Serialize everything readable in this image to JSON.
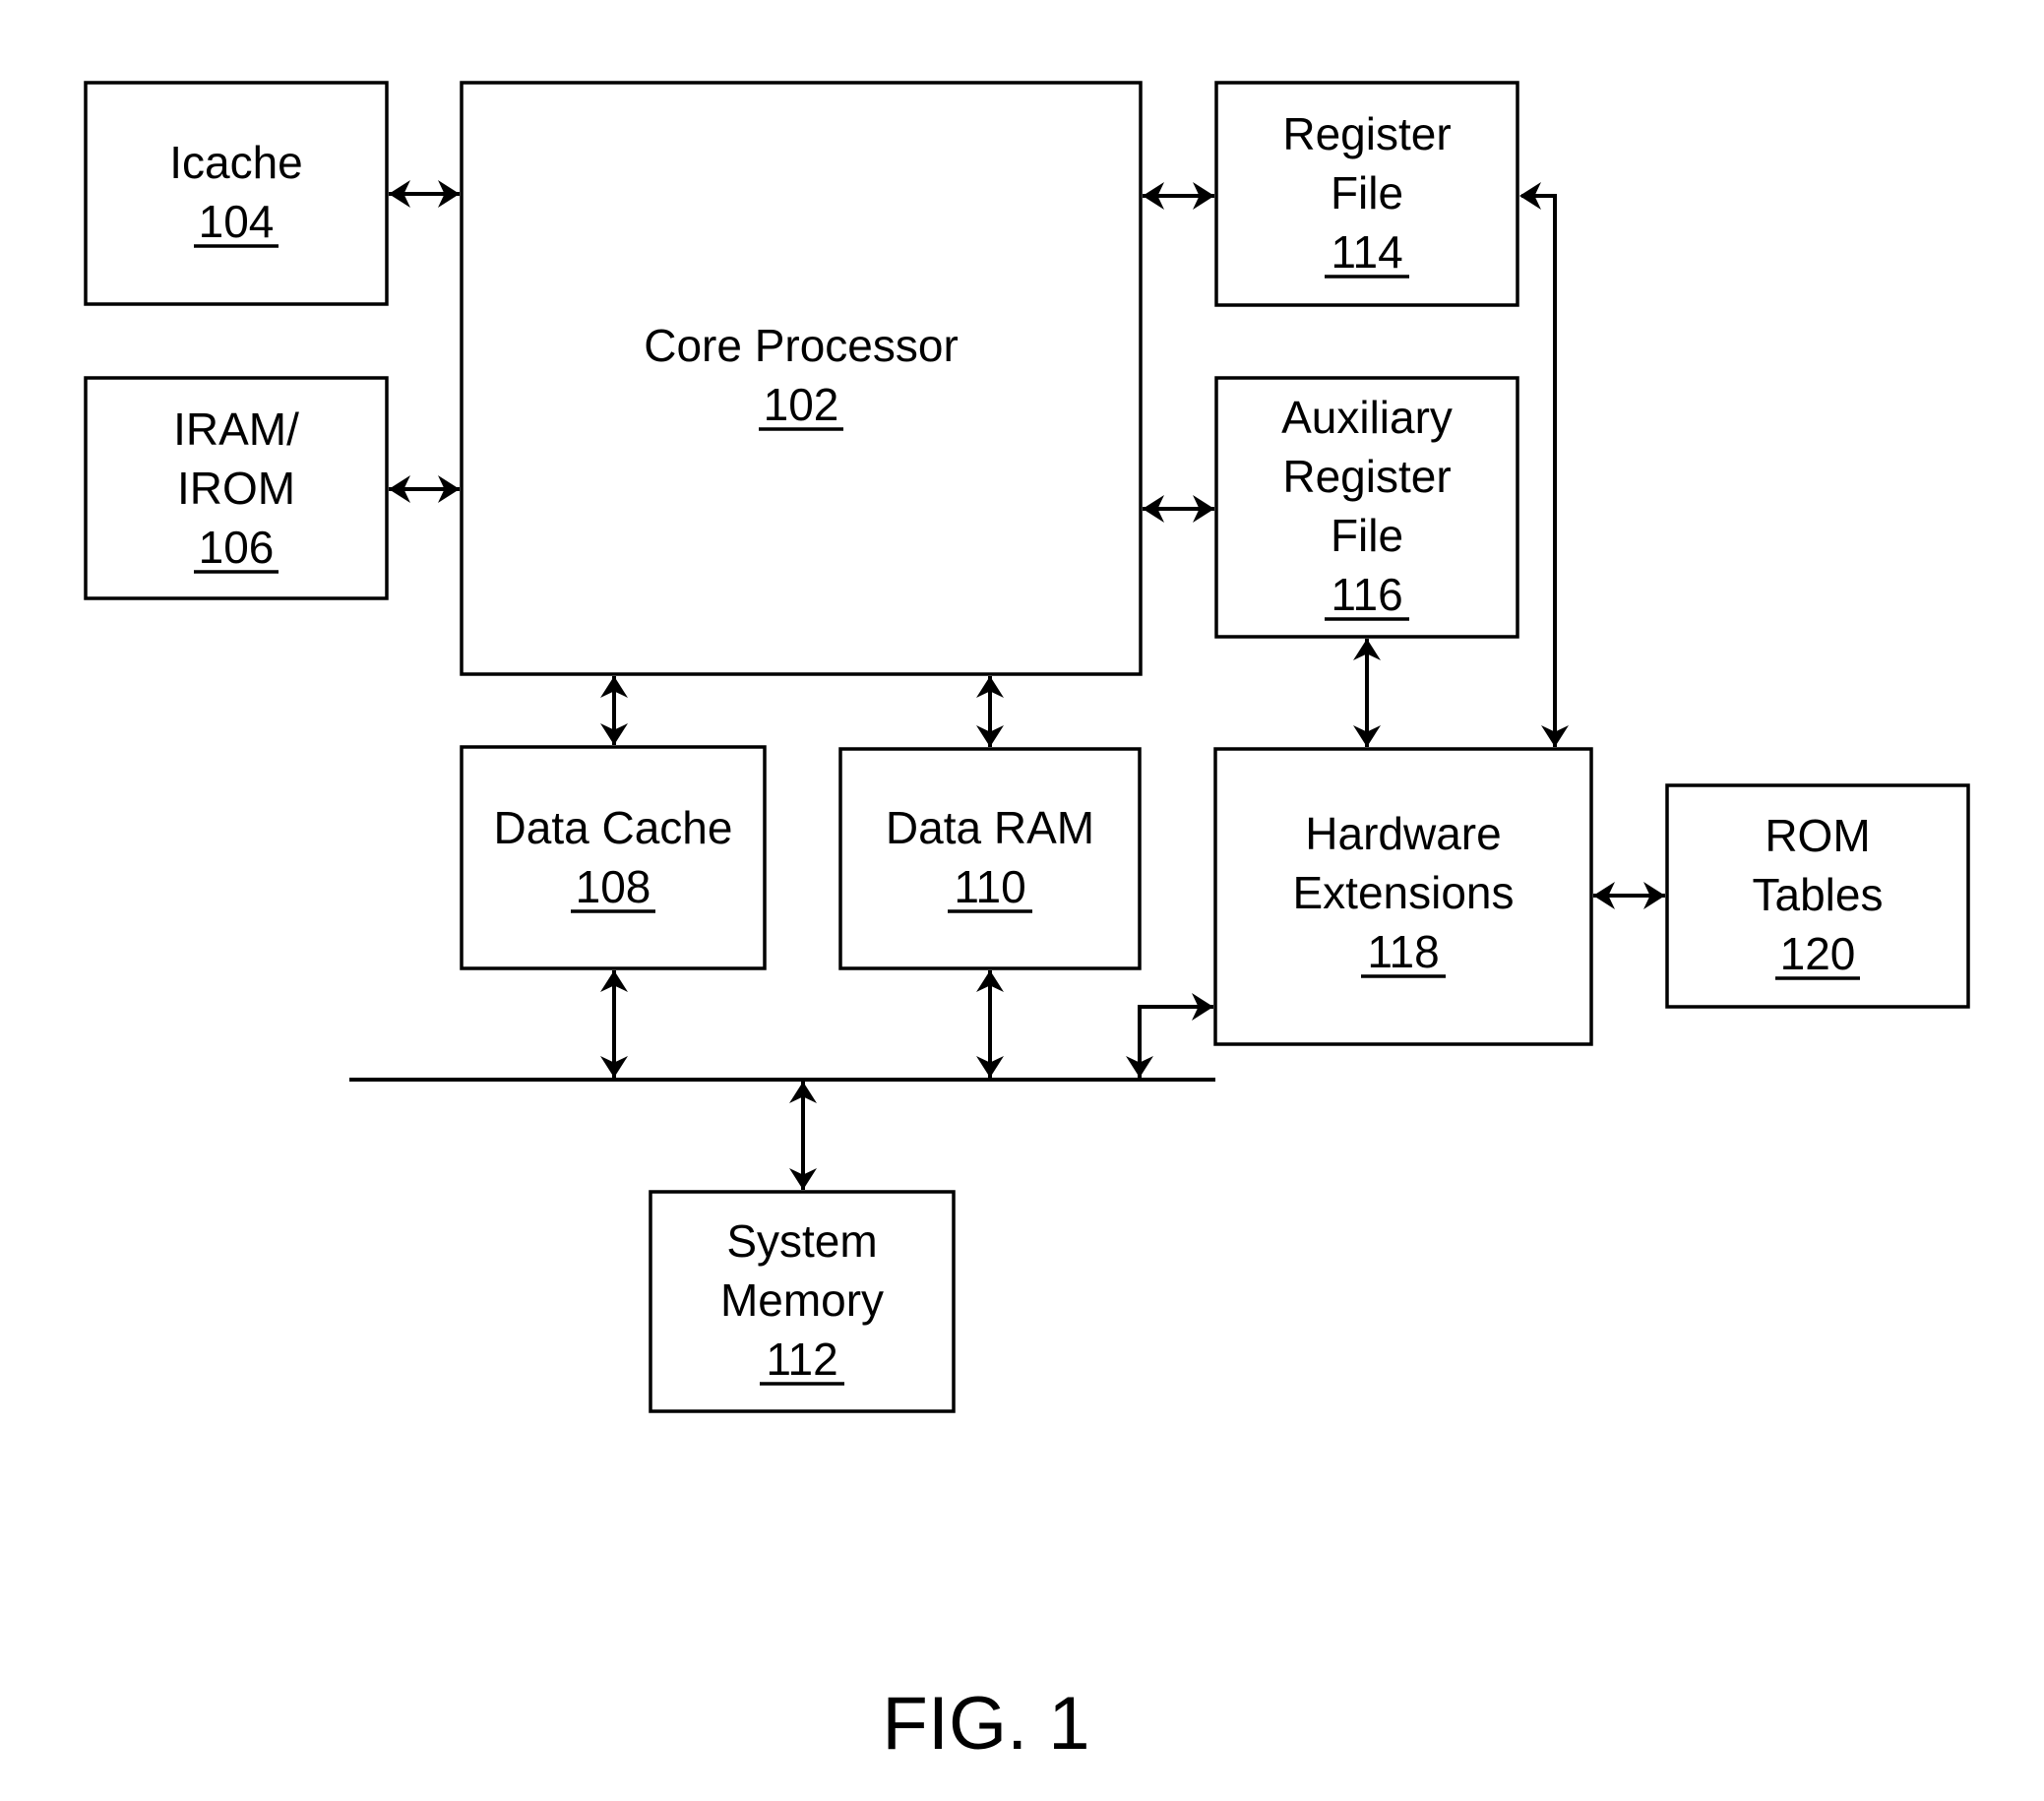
{
  "figure": {
    "caption": "FIG. 1",
    "type": "block diagram"
  },
  "blocks": [
    {
      "id": "icache",
      "lines": [
        "Icache"
      ],
      "ref": "104"
    },
    {
      "id": "iram-irom",
      "lines": [
        "IRAM/",
        "IROM"
      ],
      "ref": "106"
    },
    {
      "id": "core-processor",
      "lines": [
        "Core Processor"
      ],
      "ref": "102"
    },
    {
      "id": "register-file",
      "lines": [
        "Register",
        "File"
      ],
      "ref": "114"
    },
    {
      "id": "auxiliary-register-file",
      "lines": [
        "Auxiliary",
        "Register",
        "File"
      ],
      "ref": "116"
    },
    {
      "id": "data-cache",
      "lines": [
        "Data Cache"
      ],
      "ref": "108"
    },
    {
      "id": "data-ram",
      "lines": [
        "Data RAM"
      ],
      "ref": "110"
    },
    {
      "id": "hardware-extensions",
      "lines": [
        "Hardware",
        "Extensions"
      ],
      "ref": "118"
    },
    {
      "id": "rom-tables",
      "lines": [
        "ROM",
        "Tables"
      ],
      "ref": "120"
    },
    {
      "id": "system-memory",
      "lines": [
        "System",
        "Memory"
      ],
      "ref": "112"
    }
  ],
  "connections": [
    {
      "from": "icache",
      "to": "core-processor",
      "direction": "bidirectional"
    },
    {
      "from": "iram-irom",
      "to": "core-processor",
      "direction": "bidirectional"
    },
    {
      "from": "core-processor",
      "to": "register-file",
      "direction": "bidirectional"
    },
    {
      "from": "core-processor",
      "to": "auxiliary-register-file",
      "direction": "bidirectional"
    },
    {
      "from": "core-processor",
      "to": "data-cache",
      "direction": "bidirectional"
    },
    {
      "from": "core-processor",
      "to": "data-ram",
      "direction": "bidirectional"
    },
    {
      "from": "auxiliary-register-file",
      "to": "hardware-extensions",
      "direction": "bidirectional"
    },
    {
      "from": "register-file",
      "to": "hardware-extensions",
      "direction": "bidirectional"
    },
    {
      "from": "hardware-extensions",
      "to": "rom-tables",
      "direction": "bidirectional"
    },
    {
      "from": "data-cache",
      "to": "bus",
      "direction": "bidirectional"
    },
    {
      "from": "data-ram",
      "to": "bus",
      "direction": "bidirectional"
    },
    {
      "from": "bus",
      "to": "hardware-extensions",
      "direction": "bidirectional"
    },
    {
      "from": "bus",
      "to": "system-memory",
      "direction": "bidirectional"
    }
  ]
}
